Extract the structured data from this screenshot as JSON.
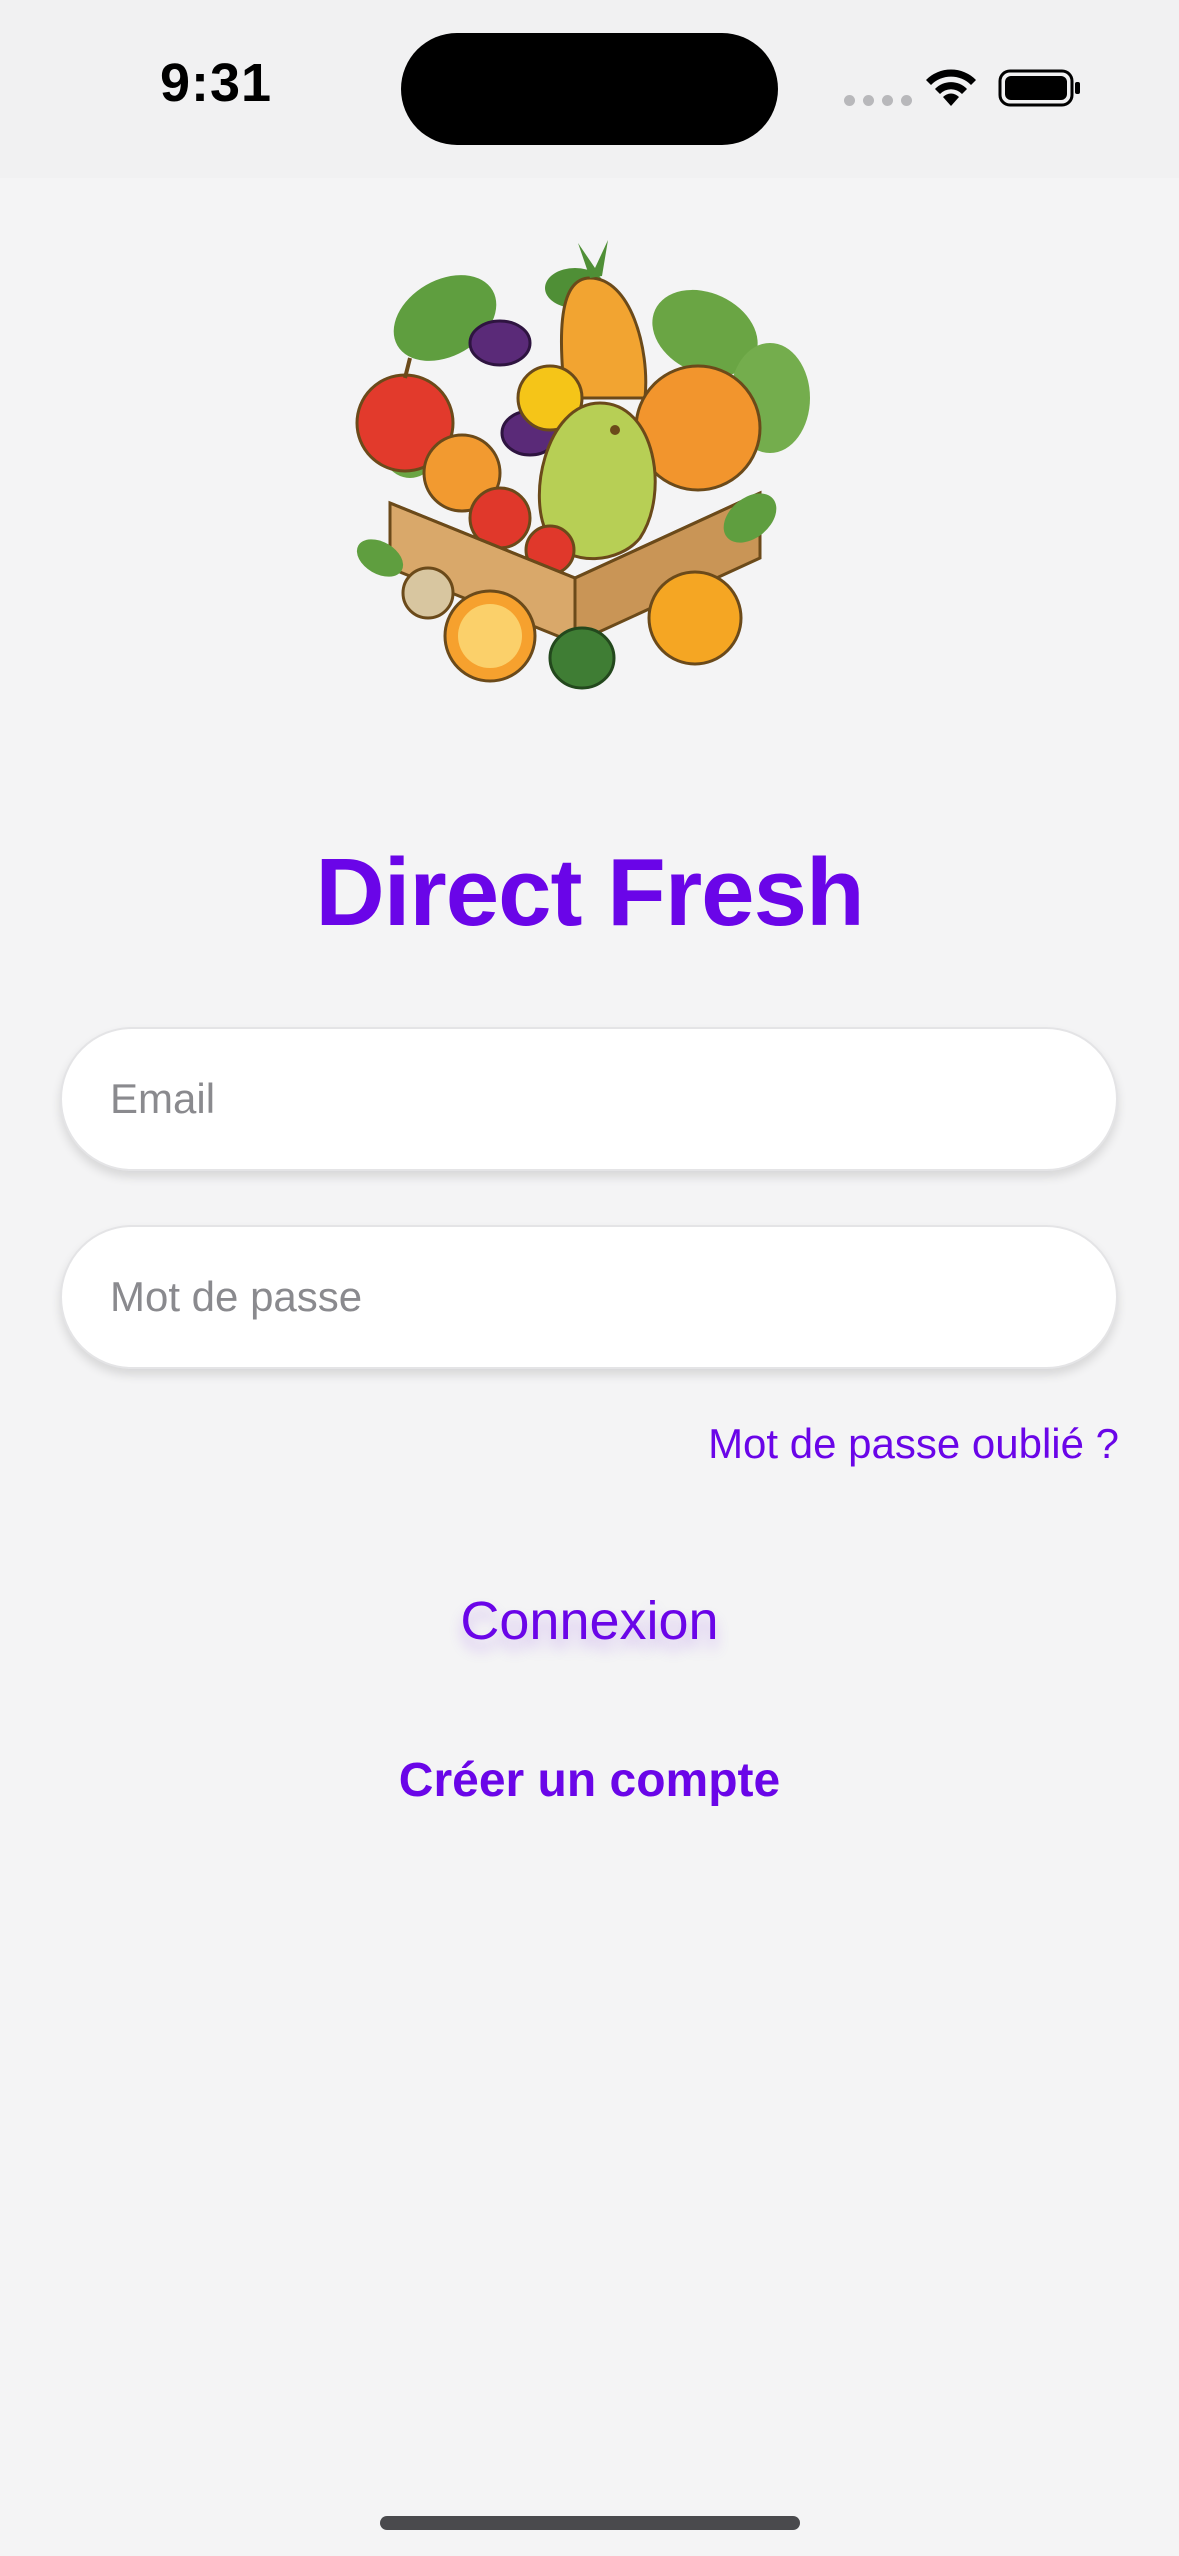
{
  "status_bar": {
    "time": "9:31"
  },
  "app": {
    "title": "Direct Fresh",
    "logo_icon": "fruit-vegetable-crate-logo"
  },
  "form": {
    "email_placeholder": "Email",
    "email_value": "",
    "password_placeholder": "Mot de passe",
    "password_value": "",
    "forgot_password_label": "Mot de passe oublié ?",
    "login_label": "Connexion",
    "create_account_label": "Créer un compte"
  },
  "colors": {
    "accent": "#6a05e8",
    "background": "#f4f4f5"
  }
}
